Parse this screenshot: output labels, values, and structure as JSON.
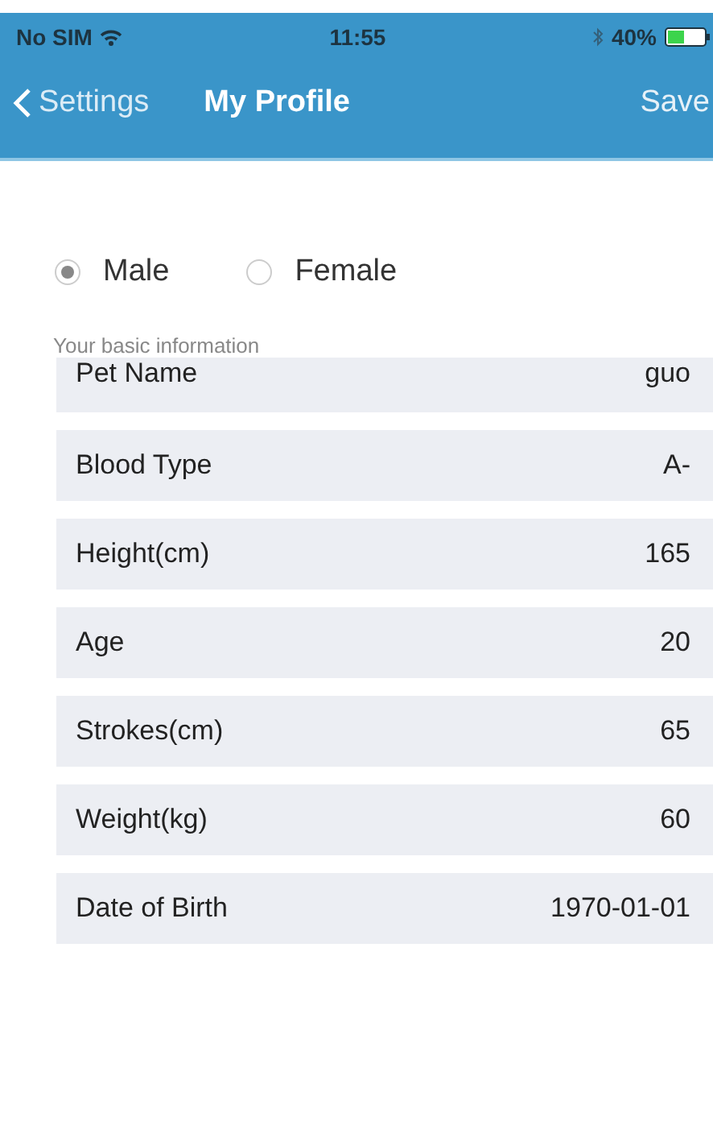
{
  "status_bar": {
    "carrier": "No SIM",
    "time": "11:55",
    "battery": "40%"
  },
  "nav": {
    "back": "Settings",
    "title": "My Profile",
    "action": "Save"
  },
  "gender": [
    {
      "label": "Male",
      "selected": true
    },
    {
      "label": "Female",
      "selected": false
    }
  ],
  "section_header": "Your basic information",
  "fields": [
    {
      "label": "Pet Name",
      "value": "guo"
    },
    {
      "label": "Blood Type",
      "value": "A-"
    },
    {
      "label": "Height(cm)",
      "value": "165"
    },
    {
      "label": "Age",
      "value": "20"
    },
    {
      "label": "Strokes(cm)",
      "value": "65"
    },
    {
      "label": "Weight(kg)",
      "value": "60"
    },
    {
      "label": "Date of Birth",
      "value": "1970-01-01"
    }
  ]
}
